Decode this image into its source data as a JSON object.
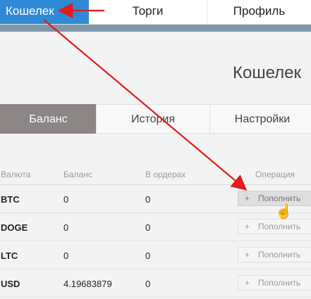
{
  "topnav": {
    "tabs": [
      {
        "label": "Кошелек"
      },
      {
        "label": "Торги"
      },
      {
        "label": "Профиль"
      }
    ]
  },
  "page": {
    "title": "Кошелек"
  },
  "subtabs": [
    {
      "label": "Баланс"
    },
    {
      "label": "История"
    },
    {
      "label": "Настройки"
    }
  ],
  "table": {
    "headers": [
      "Валюта",
      "Баланс",
      "В ордерах",
      "Операция"
    ],
    "rows": [
      {
        "currency": "BTC",
        "balance": "0",
        "in_orders": "0",
        "action": "Пополнить"
      },
      {
        "currency": "DOGE",
        "balance": "0",
        "in_orders": "0",
        "action": "Пополнить"
      },
      {
        "currency": "LTC",
        "balance": "0",
        "in_orders": "0",
        "action": "Пополнить"
      },
      {
        "currency": "USD",
        "balance": "4.19683879",
        "in_orders": "0",
        "action": "Пополнить"
      }
    ],
    "action_plus": "+"
  },
  "colors": {
    "active_nav": "#2f8ad6",
    "active_subtab": "#8c8585",
    "annotation_arrow": "#e31b1b"
  },
  "icons": [
    "plus-icon",
    "hand-pointer-icon",
    "annotation-arrow"
  ]
}
